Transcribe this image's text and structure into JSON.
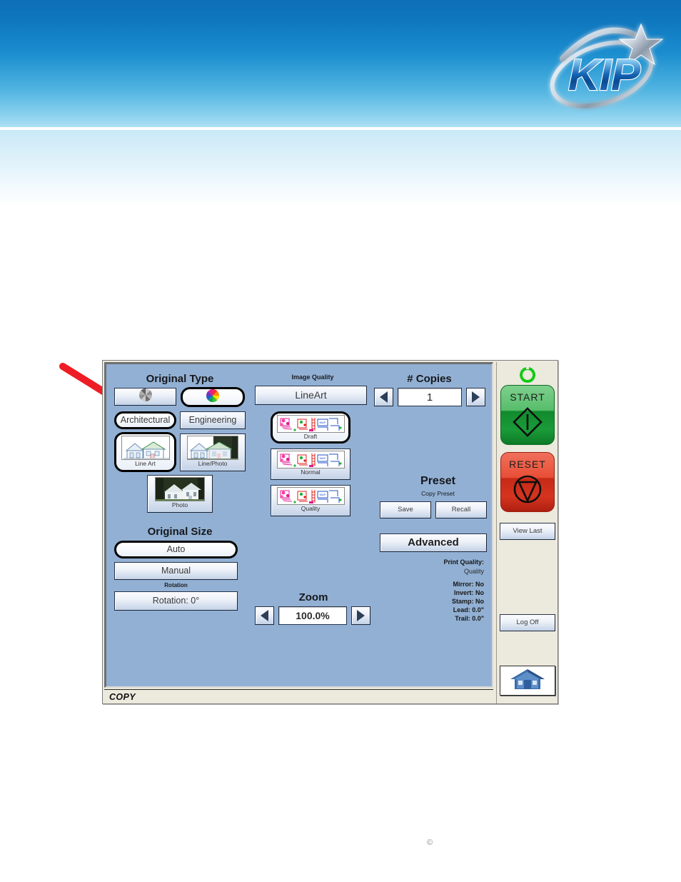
{
  "header": {
    "logo_text": "KIP",
    "logo_alt": "kip-logo"
  },
  "panel": {
    "status_bar_text": "COPY"
  },
  "original_type": {
    "title": "Original Type",
    "mode_buttons": [
      {
        "name": "grayscale-wheel-button",
        "icon": "grayscale-wheel-icon",
        "selected": false
      },
      {
        "name": "color-wheel-button",
        "icon": "color-wheel-icon",
        "selected": true
      }
    ],
    "category_buttons": [
      {
        "label": "Architectural",
        "selected": true
      },
      {
        "label": "Engineering",
        "selected": false
      }
    ],
    "content_buttons": [
      {
        "label": "Line Art",
        "icon": "house-line-art-thumbnail",
        "selected": true
      },
      {
        "label": "Line/Photo",
        "icon": "house-line-photo-thumbnail",
        "selected": false
      },
      {
        "label": "Photo",
        "icon": "house-photo-thumbnail",
        "selected": false
      }
    ]
  },
  "original_size": {
    "title": "Original Size",
    "auto_label": "Auto",
    "auto_selected": true,
    "manual_label": "Manual",
    "rotation_title": "Rotation",
    "rotation_label": "Rotation: 0°"
  },
  "image_quality": {
    "title": "Image Quality",
    "mode_label": "LineArt",
    "levels": [
      {
        "label": "Draft",
        "icon": "map-drawing-thumbnail",
        "selected": true
      },
      {
        "label": "Normal",
        "icon": "map-drawing-thumbnail",
        "selected": false
      },
      {
        "label": "Quality",
        "icon": "map-drawing-thumbnail",
        "selected": false
      }
    ]
  },
  "copies": {
    "title": "# Copies",
    "value": "1",
    "decrement_icon": "left-triangle-icon",
    "increment_icon": "right-triangle-icon"
  },
  "zoom": {
    "title": "Zoom",
    "value": "100.0%",
    "decrement_icon": "left-triangle-icon",
    "increment_icon": "right-triangle-icon"
  },
  "preset": {
    "title": "Preset",
    "subtitle": "Copy Preset",
    "save_label": "Save",
    "recall_label": "Recall"
  },
  "advanced": {
    "label": "Advanced"
  },
  "settings_summary": {
    "print_quality_label": "Print Quality:",
    "print_quality_value": "Quality",
    "lines": [
      "Mirror: No",
      "Invert: No",
      "Stamp: No",
      "Lead: 0.0\"",
      "Trail: 0.0\""
    ]
  },
  "side_panel": {
    "power_indicator": "power-ring-icon",
    "start_label": "START",
    "start_icon": "start-diamond-icon",
    "reset_label": "RESET",
    "reset_icon": "reset-triangle-icon",
    "view_last_label": "View Last",
    "log_off_label": "Log Off",
    "home_icon": "home-icon"
  },
  "annotation": {
    "arrow": "red-callout-arrow"
  },
  "footer": {
    "copyright_symbol": "©"
  },
  "colors": {
    "panel_blue": "#92b0d3",
    "panel_beige": "#ece9dd",
    "start_green": "#1a9b39",
    "reset_red": "#d5341f",
    "header_blue": "#0d6fb8",
    "annotation_red": "#ee1c24"
  }
}
